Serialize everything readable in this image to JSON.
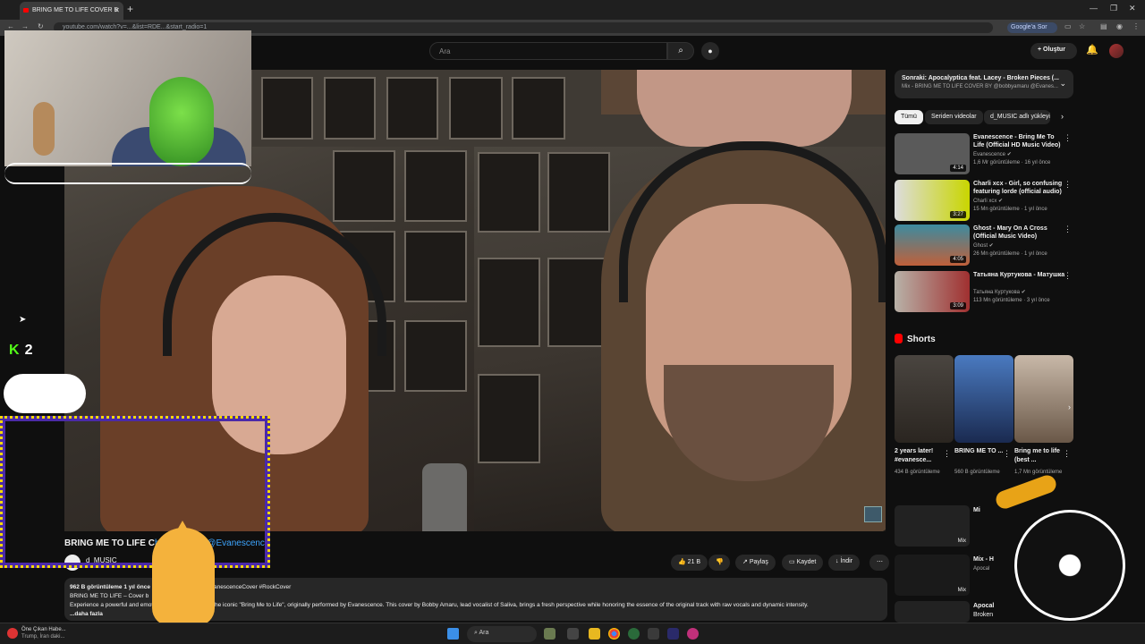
{
  "browser": {
    "tab_title": "BRING ME TO LIFE COVER B",
    "tab_close": "✕",
    "new_tab": "+",
    "url": "youtube.com/watch?v=...&list=RDE...&start_radio=1",
    "google_button": "Google'a Sor",
    "window_controls": [
      "—",
      "❐",
      "✕"
    ]
  },
  "youtube_header": {
    "search_placeholder": "Ara",
    "create_label": "Oluştur"
  },
  "video": {
    "title": "BRING ME TO LIFE C",
    "title_tags": "bobbyamaru @Evanescence",
    "channel": "d_MUSIC",
    "actions": {
      "like_count": "21 B",
      "share": "Paylaş",
      "save": "Kaydet",
      "download": "İndir",
      "more": "⋯"
    },
    "description": {
      "meta": "962 B görüntüleme  1 yıl önce",
      "hashtags": "#EvanescenceCover #RockCover",
      "line1": "BRING ME TO LIFE – Cover b",
      "line2_left": "Experience a powerful and emoti",
      "line2_right": "tion of the iconic \"Bring Me to Life\", originally performed by Evanescence. This cover by Bobby Amaru, lead vocalist of Saliva, brings a fresh perspective while honoring the essence of the original track with raw vocals and dynamic intensity.",
      "more": "...daha fazla"
    }
  },
  "sidebar": {
    "next_title": "Sonraki: Apocalyptica feat. Lacey - Broken Pieces (...",
    "next_sub": "Mix - BRING ME TO LIFE COVER BY @bobbyamaru @Evanes...",
    "chips": [
      "Tümü",
      "Seriden videolar",
      "d_MUSIC adlı yükleyi"
    ],
    "recommendations": [
      {
        "title": "Evanescence - Bring Me To Life (Official HD Music Video) ft. ...",
        "channel": "Evanescence ✔",
        "views": "1,6 Mr görüntüleme · 16 yıl önce",
        "duration": "4:14",
        "color": "#5a5a5a"
      },
      {
        "title": "Charli xcx - Girl, so confusing featuring lorde (official audio)",
        "channel": "Charli xcx ✔",
        "views": "15 Mn görüntüleme · 1 yıl önce",
        "duration": "3:27",
        "color": "#c9d600"
      },
      {
        "title": "Ghost - Mary On A Cross (Official Music Video)",
        "channel": "Ghost ✔",
        "views": "26 Mn görüntüleme · 1 yıl önce",
        "duration": "4:05",
        "color": "#2d6b7a"
      },
      {
        "title": "Татьяна Куртукова - Матушка",
        "channel": "Татьяна Куртукова ✔",
        "views": "113 Mn görüntüleme · 3 yıl önce",
        "duration": "3:09",
        "color": "#b8b2a8"
      }
    ],
    "shorts_heading": "Shorts",
    "shorts": [
      {
        "title": "2 years later! #evanesce...",
        "views": "434 B görüntüleme",
        "color": "#5a5248"
      },
      {
        "title": "BRING ME TO ...",
        "views": "560 B görüntüleme",
        "color": "#3a5a8a"
      },
      {
        "title": "Bring me to life (best ...",
        "views": "1,7 Mn görüntüleme",
        "color": "#8a7868"
      }
    ],
    "mix_items": [
      {
        "title": "Mi",
        "badge": "Mix"
      },
      {
        "title": "Mix - H",
        "sub": "Apocal",
        "badge": "Mix"
      },
      {
        "title": "Apocal",
        "sub": "Broken",
        "badge": ""
      }
    ]
  },
  "overlays": {
    "kick_count": "2",
    "kick_logo": "K"
  },
  "taskbar": {
    "news_title": "Öne Çıkan Habe...",
    "news_sub": "Trump, İran daki...",
    "search": "Ara"
  }
}
